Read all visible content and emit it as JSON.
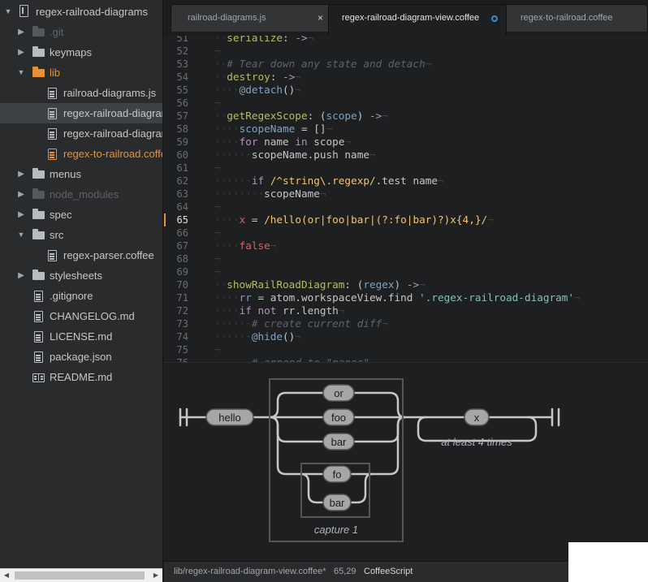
{
  "tree": {
    "root_label": "regex-railroad-diagrams",
    "items": [
      {
        "label": ".git",
        "kind": "folder",
        "expand": "closed",
        "depth": 1,
        "muted": true
      },
      {
        "label": "keymaps",
        "kind": "folder",
        "expand": "closed",
        "depth": 1
      },
      {
        "label": "lib",
        "kind": "folder",
        "expand": "open",
        "depth": 1,
        "modified": true
      },
      {
        "label": "railroad-diagrams.js",
        "kind": "file",
        "depth": 2
      },
      {
        "label": "regex-railroad-diagram-view.coffee",
        "kind": "file",
        "depth": 2,
        "selected": true
      },
      {
        "label": "regex-railroad-diagrams.coffee",
        "kind": "file",
        "depth": 2
      },
      {
        "label": "regex-to-railroad.coffee",
        "kind": "file",
        "depth": 2,
        "modified": true
      },
      {
        "label": "menus",
        "kind": "folder",
        "expand": "closed",
        "depth": 1
      },
      {
        "label": "node_modules",
        "kind": "folder",
        "expand": "closed",
        "depth": 1,
        "muted": true
      },
      {
        "label": "spec",
        "kind": "folder",
        "expand": "closed",
        "depth": 1
      },
      {
        "label": "src",
        "kind": "folder",
        "expand": "open",
        "depth": 1
      },
      {
        "label": "regex-parser.coffee",
        "kind": "file",
        "depth": 2
      },
      {
        "label": "stylesheets",
        "kind": "folder",
        "expand": "closed",
        "depth": 1
      },
      {
        "label": ".gitignore",
        "kind": "file",
        "depth": 1
      },
      {
        "label": "CHANGELOG.md",
        "kind": "file",
        "depth": 1
      },
      {
        "label": "LICENSE.md",
        "kind": "file",
        "depth": 1
      },
      {
        "label": "package.json",
        "kind": "file",
        "depth": 1
      },
      {
        "label": "README.md",
        "kind": "book",
        "depth": 1
      }
    ]
  },
  "tabs": [
    {
      "title": "railroad-diagrams.js",
      "state": "close",
      "close_glyph": "×"
    },
    {
      "title": "regex-railroad-diagram-view.coffee",
      "state": "modified",
      "active": true
    },
    {
      "title": "regex-to-railroad.coffee",
      "state": "none"
    }
  ],
  "editor": {
    "current_line": 65,
    "lines": [
      {
        "n": 51,
        "segs": [
          [
            "inv",
            "··"
          ],
          [
            "fn",
            "serialize"
          ],
          [
            "",
            ": "
          ],
          [
            "arr",
            "->"
          ],
          [
            "inv",
            "¬"
          ]
        ]
      },
      {
        "n": 52,
        "segs": [
          [
            "inv",
            "¬"
          ]
        ]
      },
      {
        "n": 53,
        "segs": [
          [
            "inv",
            "··"
          ],
          [
            "cm",
            "# Tear down any state and detach"
          ],
          [
            "inv",
            "¬"
          ]
        ]
      },
      {
        "n": 54,
        "segs": [
          [
            "inv",
            "··"
          ],
          [
            "fn",
            "destroy"
          ],
          [
            "",
            ": "
          ],
          [
            "arr",
            "->"
          ],
          [
            "inv",
            "¬"
          ]
        ]
      },
      {
        "n": 55,
        "segs": [
          [
            "inv",
            "····"
          ],
          [
            "ivar",
            "@detach"
          ],
          [
            "",
            "()"
          ],
          [
            "inv",
            "¬"
          ]
        ]
      },
      {
        "n": 56,
        "segs": [
          [
            "inv",
            "¬"
          ]
        ]
      },
      {
        "n": 57,
        "segs": [
          [
            "inv",
            "··"
          ],
          [
            "fn",
            "getRegexScope"
          ],
          [
            "",
            ": ("
          ],
          [
            "prm",
            "scope"
          ],
          [
            "",
            ") "
          ],
          [
            "arr",
            "->"
          ],
          [
            "inv",
            "¬"
          ]
        ]
      },
      {
        "n": 58,
        "segs": [
          [
            "inv",
            "····"
          ],
          [
            "prm",
            "scopeName"
          ],
          [
            "",
            " = []"
          ],
          [
            "inv",
            "¬"
          ]
        ]
      },
      {
        "n": 59,
        "segs": [
          [
            "inv",
            "····"
          ],
          [
            "kw",
            "for"
          ],
          [
            "",
            " name "
          ],
          [
            "kw",
            "in"
          ],
          [
            "",
            " scope"
          ],
          [
            "inv",
            "¬"
          ]
        ]
      },
      {
        "n": 60,
        "segs": [
          [
            "inv",
            "······"
          ],
          [
            "",
            "scopeName.push name"
          ],
          [
            "inv",
            "¬"
          ]
        ]
      },
      {
        "n": 61,
        "segs": [
          [
            "inv",
            "¬"
          ]
        ]
      },
      {
        "n": 62,
        "segs": [
          [
            "inv",
            "······"
          ],
          [
            "kw",
            "if"
          ],
          [
            "",
            " "
          ],
          [
            "re",
            "/^string\\.regexp/"
          ],
          [
            "",
            ".test name"
          ],
          [
            "inv",
            "¬"
          ]
        ]
      },
      {
        "n": 63,
        "segs": [
          [
            "inv",
            "········"
          ],
          [
            "",
            "scopeName"
          ],
          [
            "inv",
            "¬"
          ]
        ]
      },
      {
        "n": 64,
        "segs": [
          [
            "inv",
            "¬"
          ]
        ]
      },
      {
        "n": 65,
        "segs": [
          [
            "inv",
            "····"
          ],
          [
            "var",
            "x"
          ],
          [
            "",
            " = "
          ],
          [
            "re",
            "/hello(or|foo|bar|(?:fo|bar)?)x{4,}/"
          ],
          [
            "inv",
            "¬"
          ]
        ]
      },
      {
        "n": 66,
        "segs": [
          [
            "inv",
            "¬"
          ]
        ]
      },
      {
        "n": 67,
        "segs": [
          [
            "inv",
            "····"
          ],
          [
            "var",
            "false"
          ],
          [
            "inv",
            "¬"
          ]
        ]
      },
      {
        "n": 68,
        "segs": [
          [
            "inv",
            "¬"
          ]
        ]
      },
      {
        "n": 69,
        "segs": [
          [
            "inv",
            "¬"
          ]
        ]
      },
      {
        "n": 70,
        "segs": [
          [
            "inv",
            "··"
          ],
          [
            "fn",
            "showRailRoadDiagram"
          ],
          [
            "",
            ": ("
          ],
          [
            "prm",
            "regex"
          ],
          [
            "",
            ") "
          ],
          [
            "arr",
            "->"
          ],
          [
            "inv",
            "¬"
          ]
        ]
      },
      {
        "n": 71,
        "segs": [
          [
            "inv",
            "····"
          ],
          [
            "prm",
            "rr"
          ],
          [
            "",
            " = atom.workspaceView.find "
          ],
          [
            "str",
            "'.regex-railroad-diagram'"
          ],
          [
            "inv",
            "¬"
          ]
        ]
      },
      {
        "n": 72,
        "segs": [
          [
            "inv",
            "····"
          ],
          [
            "kw",
            "if not"
          ],
          [
            "",
            " rr.length"
          ],
          [
            "inv",
            "¬"
          ]
        ]
      },
      {
        "n": 73,
        "segs": [
          [
            "inv",
            "······"
          ],
          [
            "cm",
            "# create current diff"
          ],
          [
            "inv",
            "¬"
          ]
        ]
      },
      {
        "n": 74,
        "segs": [
          [
            "inv",
            "······"
          ],
          [
            "ivar",
            "@hide"
          ],
          [
            "",
            "()"
          ],
          [
            "inv",
            "¬"
          ]
        ]
      },
      {
        "n": 75,
        "segs": [
          [
            "inv",
            "¬"
          ]
        ]
      },
      {
        "n": 76,
        "segs": [
          [
            "inv",
            "······"
          ],
          [
            "cm",
            "# append to \"panes\""
          ],
          [
            "inv",
            "¬"
          ]
        ]
      }
    ]
  },
  "diagram": {
    "start_label": "hello",
    "alternatives": [
      "or",
      "foo",
      "bar"
    ],
    "group_items": [
      "fo",
      "bar"
    ],
    "group_caption": "capture 1",
    "repeat_item": "x",
    "repeat_caption": "at least 4 times"
  },
  "status": {
    "path": "lib/regex-railroad-diagram-view.coffee*",
    "cursor": "65,29",
    "grammar": "CoffeeScript"
  },
  "colors": {
    "modified": "#e8913a",
    "modified_tab_dot": "#2f8fd8",
    "diagram_stroke": "#c7c7c7",
    "diagram_node_fill": "#a6a6a6"
  }
}
